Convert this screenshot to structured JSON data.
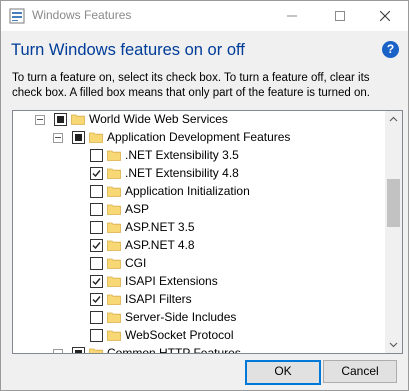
{
  "window": {
    "title": "Windows Features"
  },
  "header": {
    "heading": "Turn Windows features on or off",
    "description": "To turn a feature on, select its check box. To turn a feature off, clear its check box. A filled box means that only part of the feature is turned on."
  },
  "tree": {
    "items": [
      {
        "label": "World Wide Web Services",
        "state": "partial",
        "expanded": true,
        "level": 0
      },
      {
        "label": "Application Development Features",
        "state": "partial",
        "expanded": true,
        "level": 1
      },
      {
        "label": ".NET Extensibility 3.5",
        "state": "unchecked",
        "level": 2
      },
      {
        "label": ".NET Extensibility 4.8",
        "state": "checked",
        "level": 2
      },
      {
        "label": "Application Initialization",
        "state": "unchecked",
        "level": 2
      },
      {
        "label": "ASP",
        "state": "unchecked",
        "level": 2
      },
      {
        "label": "ASP.NET 3.5",
        "state": "unchecked",
        "level": 2
      },
      {
        "label": "ASP.NET 4.8",
        "state": "checked",
        "level": 2
      },
      {
        "label": "CGI",
        "state": "unchecked",
        "level": 2
      },
      {
        "label": "ISAPI Extensions",
        "state": "checked",
        "level": 2
      },
      {
        "label": "ISAPI Filters",
        "state": "checked",
        "level": 2
      },
      {
        "label": "Server-Side Includes",
        "state": "unchecked",
        "level": 2
      },
      {
        "label": "WebSocket Protocol",
        "state": "unchecked",
        "level": 2
      },
      {
        "label": "Common HTTP Features",
        "state": "partial",
        "expanded": false,
        "level": 1
      }
    ]
  },
  "buttons": {
    "ok": "OK",
    "cancel": "Cancel"
  },
  "colors": {
    "heading": "#003c99",
    "accent": "#0078d7",
    "folder": "#f8d775"
  }
}
